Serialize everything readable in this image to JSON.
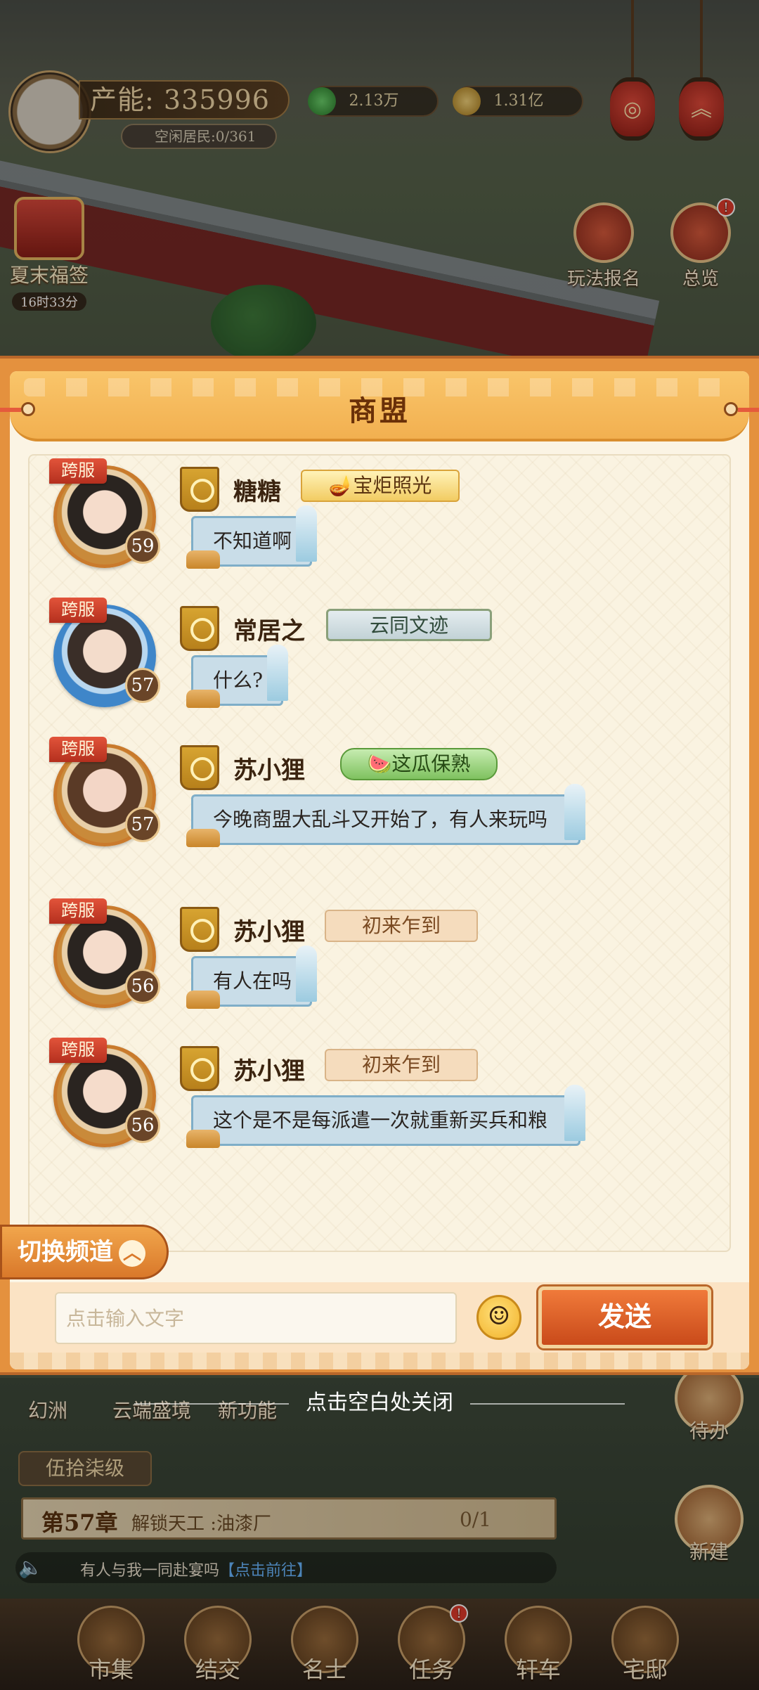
{
  "hud": {
    "energy_label": "产能: 335996",
    "idle_residents": "空闲居民:0/361",
    "jade_amount": "2.13万",
    "coin_amount": "1.31亿"
  },
  "scene_buttons": {
    "event_name": "夏末福签",
    "event_timer": "16时33分",
    "signup_label": "玩法报名",
    "overview_label": "总览",
    "overview_badge": "!"
  },
  "chat": {
    "title": "商盟",
    "messages": [
      {
        "server_tag": "跨服",
        "level": "59",
        "name": "糖糖",
        "title_badge": "宝炬照光",
        "text": "不知道啊"
      },
      {
        "server_tag": "跨服",
        "level": "57",
        "name": "常居之",
        "title_badge": "云同文迹",
        "text": "什么?"
      },
      {
        "server_tag": "跨服",
        "level": "57",
        "name": "苏小狸",
        "title_badge": "这瓜保熟",
        "text": "今晚商盟大乱斗又开始了，有人来玩吗"
      },
      {
        "server_tag": "跨服",
        "level": "56",
        "name": "苏小狸",
        "title_badge": "初来乍到",
        "text": "有人在吗"
      },
      {
        "server_tag": "跨服",
        "level": "56",
        "name": "苏小狸",
        "title_badge": "初来乍到",
        "text": "这个是不是每派遣一次就重新买兵和粮"
      }
    ],
    "switch_channel_label": "切换频道",
    "input_placeholder": "点击输入文字",
    "send_label": "发送"
  },
  "close_hint": "点击空白处关闭",
  "bottom": {
    "feature_buttons": [
      "幻洲",
      "云端盛境",
      "新功能"
    ],
    "todo_label": "待办",
    "build_label": "新建",
    "level_chip": "伍拾柒级",
    "chapter_title": "第57章",
    "chapter_task": "解锁天工 :油漆厂",
    "chapter_progress": "0/1",
    "notice_text": "有人与我一同赴宴吗",
    "notice_link": "【点击前往】",
    "nav": [
      {
        "label": "市集",
        "icon": "market-icon"
      },
      {
        "label": "结交",
        "icon": "cards-icon"
      },
      {
        "label": "名士",
        "icon": "scholar-icon"
      },
      {
        "label": "任务",
        "icon": "task-icon",
        "badge": "!"
      },
      {
        "label": "轩车",
        "icon": "carriage-icon"
      },
      {
        "label": "宅邸",
        "icon": "mansion-icon"
      }
    ]
  }
}
